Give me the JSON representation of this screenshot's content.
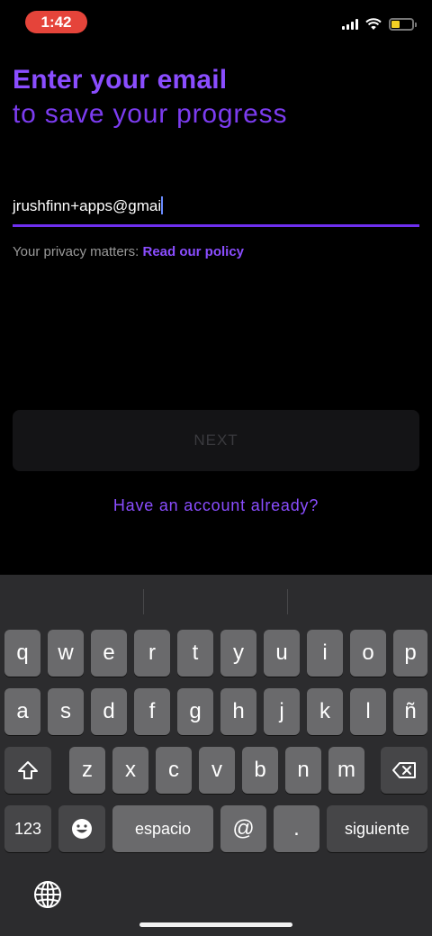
{
  "status_bar": {
    "time": "1:42",
    "battery_color": "#f4d024",
    "time_pill_color": "#e5443a"
  },
  "header": {
    "title_line1": "Enter your email",
    "title_line2": "to save your progress"
  },
  "email": {
    "value": "jrushfinn+apps@gmai"
  },
  "privacy": {
    "text": "Your privacy matters: ",
    "link": "Read our policy"
  },
  "buttons": {
    "next": "NEXT",
    "have_account": "Have an account already?"
  },
  "accent_color": "#8a4dff",
  "keyboard": {
    "row1": [
      "q",
      "w",
      "e",
      "r",
      "t",
      "y",
      "u",
      "i",
      "o",
      "p"
    ],
    "row2": [
      "a",
      "s",
      "d",
      "f",
      "g",
      "h",
      "j",
      "k",
      "l",
      "ñ"
    ],
    "row3": [
      "z",
      "x",
      "c",
      "v",
      "b",
      "n",
      "m"
    ],
    "numbers_key": "123",
    "space_key": "espacio",
    "at_key": "@",
    "dot_key": ".",
    "return_key": "siguiente",
    "icons": [
      "shift-icon",
      "delete-icon",
      "emoji-icon",
      "globe-icon"
    ]
  }
}
